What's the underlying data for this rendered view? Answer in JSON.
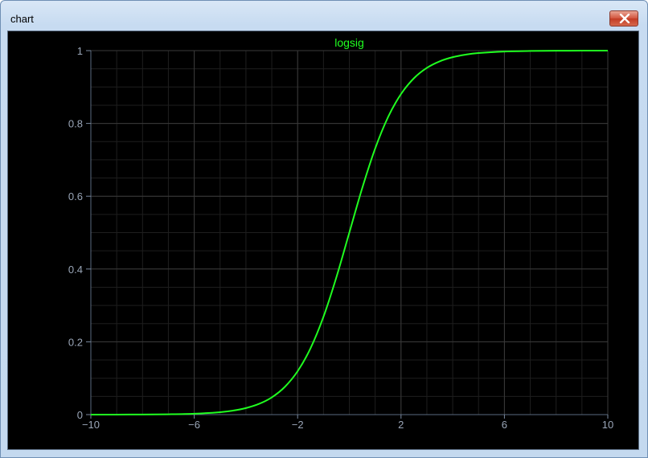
{
  "window": {
    "title": "chart"
  },
  "icons": {
    "close": "close-icon"
  },
  "colors": {
    "background": "#000000",
    "line": "#20ff20",
    "grid_major": "#3a3a3a",
    "grid_minor": "#1e1e1e",
    "tick_text": "#9aa6b8",
    "title": "#20ff20"
  },
  "chart_data": {
    "type": "line",
    "title": "logsig",
    "xlabel": "",
    "ylabel": "",
    "xlim": [
      -10,
      10
    ],
    "ylim": [
      0,
      1
    ],
    "grid": true,
    "xticks": [
      -10,
      -6,
      -2,
      2,
      6,
      10
    ],
    "xtick_labels": [
      "−10",
      "−6",
      "−2",
      "2",
      "6",
      "10"
    ],
    "yticks": [
      0,
      0.2,
      0.4,
      0.6,
      0.8,
      1
    ],
    "ytick_labels": [
      "0",
      "0.2",
      "0.4",
      "0.6",
      "0.8",
      "1"
    ],
    "series": [
      {
        "x": [
          -10,
          -9,
          -8,
          -7,
          -6,
          -5,
          -4.5,
          -4,
          -3.5,
          -3,
          -2.5,
          -2,
          -1.5,
          -1,
          -0.5,
          0,
          0.5,
          1,
          1.5,
          2,
          2.5,
          3,
          3.5,
          4,
          4.5,
          5,
          6,
          7,
          8,
          9,
          10
        ],
        "y": [
          0.0,
          0.0001,
          0.0003,
          0.0009,
          0.0025,
          0.0067,
          0.011,
          0.018,
          0.0293,
          0.0474,
          0.0759,
          0.1192,
          0.1824,
          0.2689,
          0.3775,
          0.5,
          0.6225,
          0.7311,
          0.8176,
          0.8808,
          0.9241,
          0.9526,
          0.9707,
          0.982,
          0.989,
          0.9933,
          0.9975,
          0.9991,
          0.9997,
          0.9999,
          1.0
        ]
      }
    ]
  }
}
